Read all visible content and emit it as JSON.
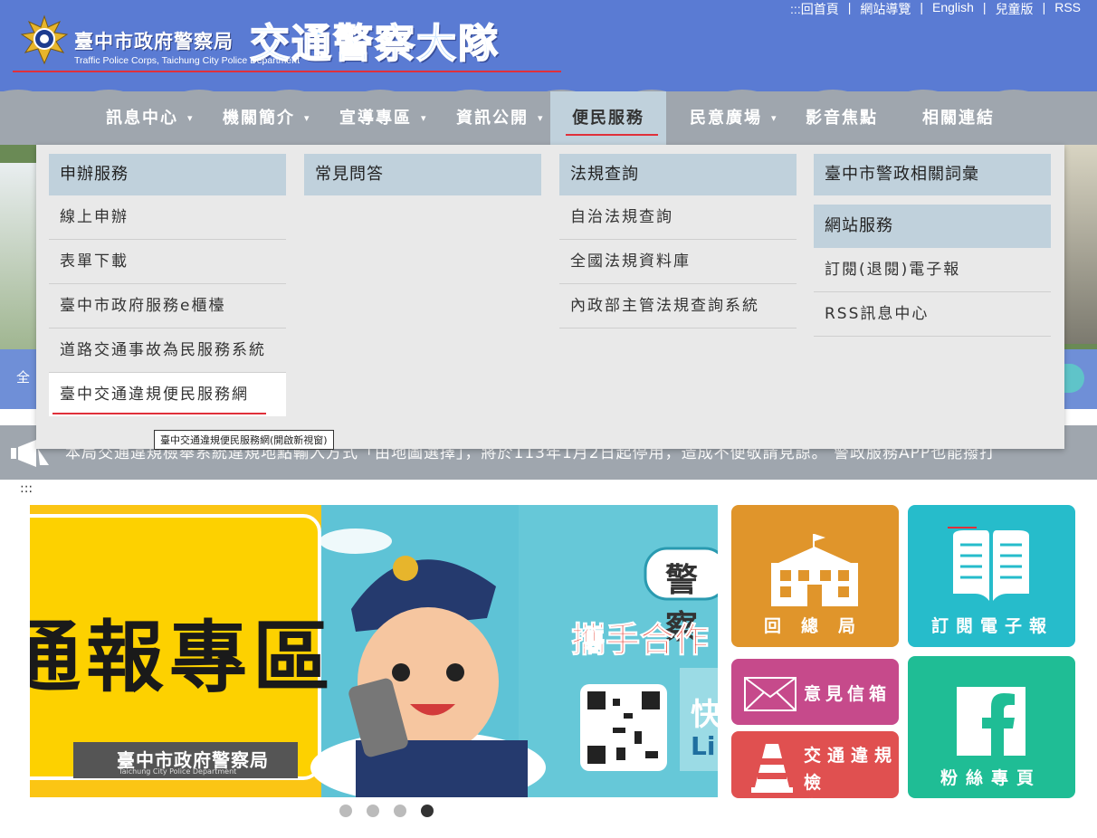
{
  "header": {
    "org_cn": "臺中市政府警察局",
    "unit_cn": "交通警察大隊",
    "org_en": "Traffic Police Corps, Taichung City Police Department"
  },
  "toplinks": [
    ":::回首頁",
    "網站導覽",
    "English",
    "兒童版",
    "RSS"
  ],
  "nav": [
    {
      "label": "訊息中心"
    },
    {
      "label": "機關簡介"
    },
    {
      "label": "宣導專區"
    },
    {
      "label": "資訊公開"
    },
    {
      "label": "便民服務"
    },
    {
      "label": "民意廣場"
    },
    {
      "label": "影音焦點"
    },
    {
      "label": "相關連結"
    }
  ],
  "mega": {
    "col1": {
      "head": "申辦服務",
      "links": [
        "線上申辦",
        "表單下載",
        "臺中市政府服務e櫃檯",
        "道路交通事故為民服務系統",
        "臺中交通違規便民服務網"
      ]
    },
    "col2": {
      "head": "常見問答"
    },
    "col3": {
      "head": "法規查詢",
      "links": [
        "自治法規查詢",
        "全國法規資料庫",
        "內政部主管法規查詢系統"
      ]
    },
    "col4": {
      "head": "臺中市警政相關詞彙",
      "head2": "網站服務",
      "links": [
        "訂閱(退閱)電子報",
        "RSS訊息中心"
      ]
    }
  },
  "tooltip": "臺中交通違規便民服務網(開啟新視窗)",
  "bg_bar_text": "全",
  "marquee": "本局交通違規檢舉系統違規地點輸入方式「由地圖選擇」，將於113年1月2日起停用，造成不便敬請見諒。  警政服務APP也能撥打",
  "anchor": ":::",
  "slider": {
    "text_big": "通報專區",
    "badge": "臺中市政府警察局",
    "badge_en": "Taichung City Police Department",
    "cloud_text": "警察",
    "red_text": "攜手合作",
    "side_text1": "快",
    "side_text2": "Li"
  },
  "tiles": {
    "t1": "回總局",
    "t2": "訂閱電子報",
    "t3": "意見信箱",
    "t4_a": "交通違規",
    "t4_b": "檢舉",
    "t5": "粉絲專頁"
  },
  "pager": {
    "count": 4,
    "current": 4
  },
  "colors": {
    "header": "#5a7bd3",
    "nav": "#9fa6ae",
    "active_nav": "#c0d1dc",
    "accent_red": "#e0303a",
    "tile_orange": "#e0952b",
    "tile_teal": "#26bccb",
    "tile_magenta": "#c64a8b",
    "tile_red": "#e05050",
    "tile_green": "#1fbd95"
  }
}
